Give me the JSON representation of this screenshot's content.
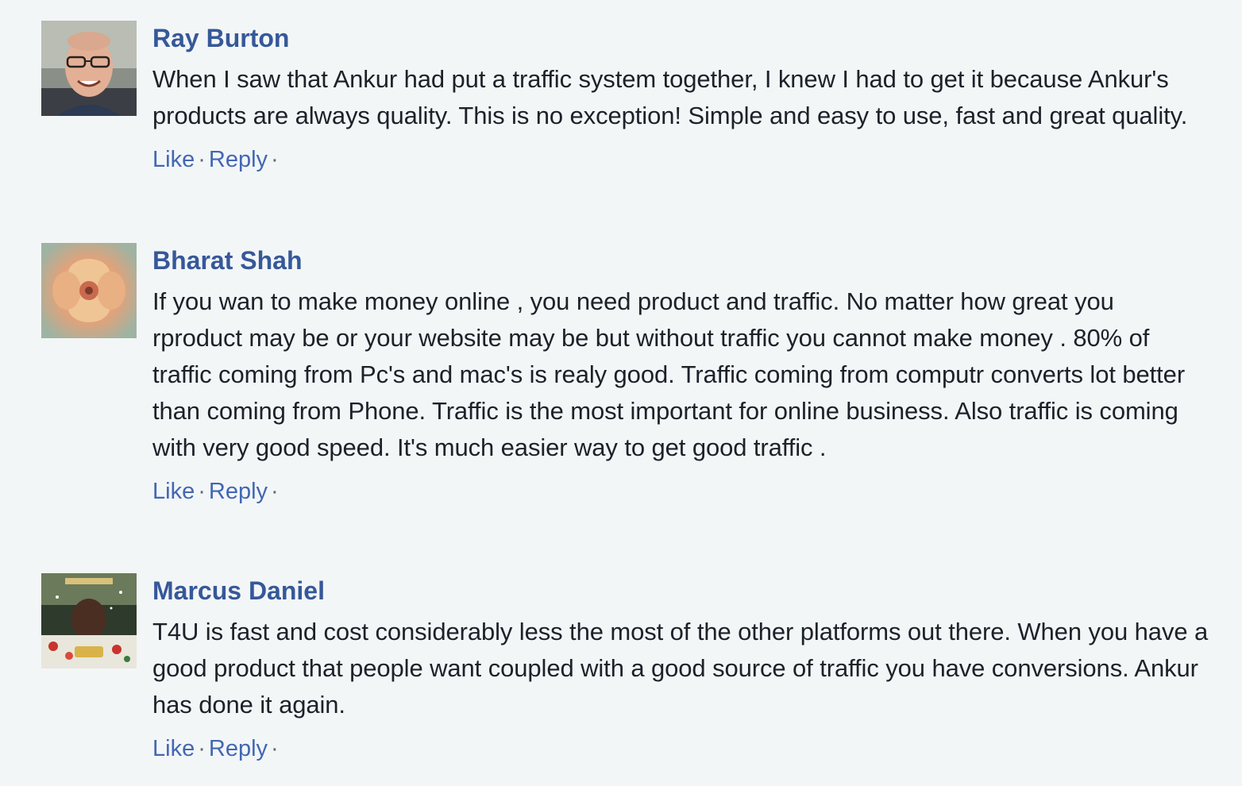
{
  "comments": [
    {
      "author": "Ray Burton",
      "text": "When I saw that Ankur had put a traffic system together, I knew I had to get it because Ankur's products are always quality. This is no exception! Simple and easy to use, fast and great quality.",
      "like_label": "Like",
      "reply_label": "Reply",
      "separator": "·"
    },
    {
      "author": "Bharat Shah",
      "text": "If you wan to make money online , you need product and traffic. No matter how great you rproduct may be or your website may be but without traffic you cannot make money . 80% of traffic coming from Pc's and mac's is realy good. Traffic coming from computr converts lot better than coming from Phone. Traffic is the most important for online business. Also traffic is coming with very good speed. It's much easier way to get good traffic .",
      "like_label": "Like",
      "reply_label": "Reply",
      "separator": "·"
    },
    {
      "author": "Marcus Daniel",
      "text": "T4U is fast and cost considerably less the most of the other platforms out there. When you have a good product that people want coupled with a good source of traffic you have conversions. Ankur has done it again.",
      "like_label": "Like",
      "reply_label": "Reply",
      "separator": "·"
    }
  ]
}
